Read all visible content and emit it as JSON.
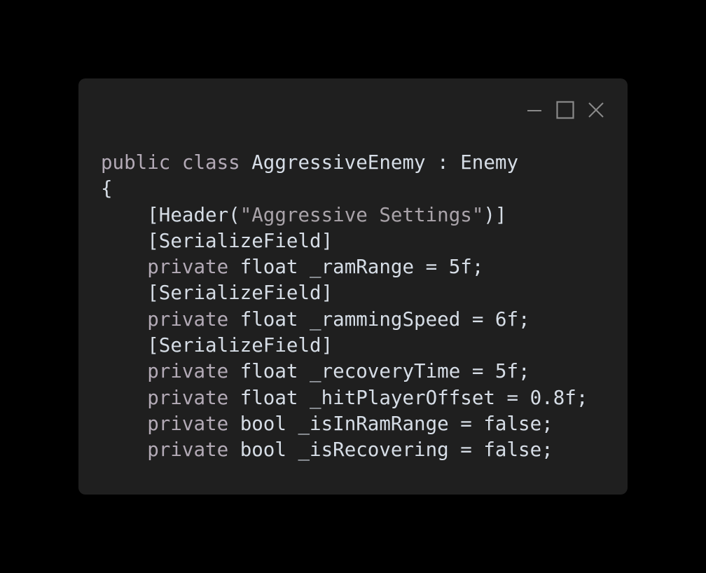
{
  "window": {
    "background": "#1f1f1f",
    "controls": {
      "minimize": "minimize-icon",
      "maximize": "maximize-icon",
      "close": "close-icon"
    }
  },
  "code": {
    "lines": [
      {
        "indent": "",
        "kw": "public class ",
        "rest": "AggressiveEnemy : Enemy"
      },
      {
        "indent": "",
        "kw": "",
        "rest": "{"
      },
      {
        "indent": "    ",
        "kw": "",
        "rest": "[Header(",
        "str": "\"Aggressive Settings\"",
        "tail": ")]"
      },
      {
        "indent": "    ",
        "kw": "",
        "rest": "[SerializeField]"
      },
      {
        "indent": "    ",
        "kw": "private ",
        "rest": "float _ramRange = 5f;"
      },
      {
        "indent": "    ",
        "kw": "",
        "rest": "[SerializeField]"
      },
      {
        "indent": "    ",
        "kw": "private ",
        "rest": "float _rammingSpeed = 6f;"
      },
      {
        "indent": "    ",
        "kw": "",
        "rest": "[SerializeField]"
      },
      {
        "indent": "    ",
        "kw": "private ",
        "rest": "float _recoveryTime = 5f;"
      },
      {
        "indent": "    ",
        "kw": "private ",
        "rest": "float _hitPlayerOffset = 0.8f;"
      },
      {
        "indent": "    ",
        "kw": "private ",
        "rest": "bool _isInRamRange = false;"
      },
      {
        "indent": "    ",
        "kw": "private ",
        "rest": "bool _isRecovering = false;"
      }
    ]
  }
}
